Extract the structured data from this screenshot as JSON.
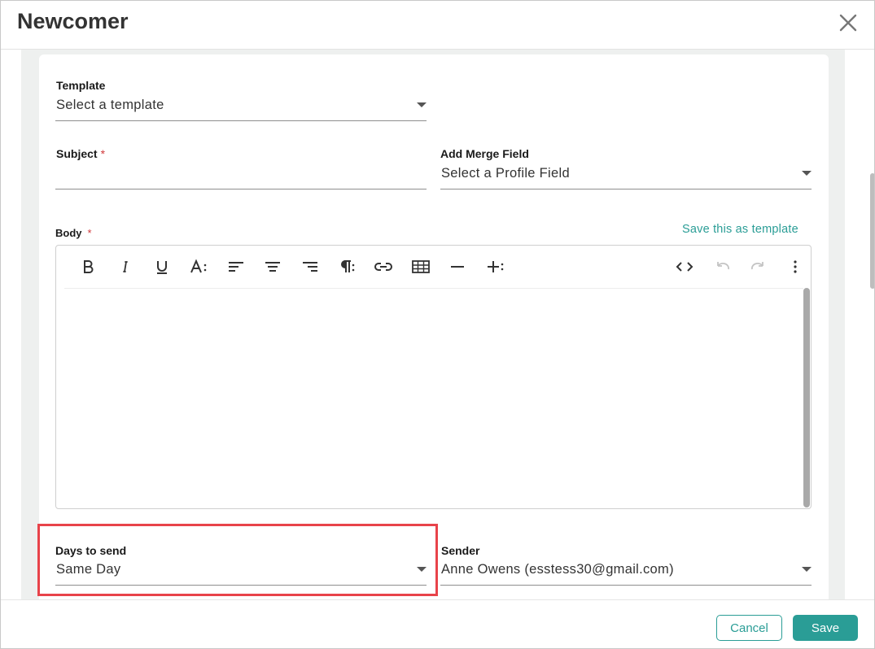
{
  "dialog": {
    "title": "Newcomer"
  },
  "form": {
    "template": {
      "label": "Template",
      "value": "Select a template"
    },
    "subject": {
      "label": "Subject",
      "required_mark": "*",
      "value": ""
    },
    "merge_field": {
      "label": "Add Merge Field",
      "value": "Select a Profile Field"
    },
    "body": {
      "label": "Body",
      "required_mark": "*",
      "save_template_link": "Save this as template"
    },
    "days_to_send": {
      "label": "Days to send",
      "value": "Same Day"
    },
    "sender": {
      "label": "Sender",
      "value": "Anne Owens (esstess30@gmail.com)"
    }
  },
  "toolbar": {
    "icons": [
      "bold-icon",
      "italic-icon",
      "underline-icon",
      "font-size-icon",
      "align-left-icon",
      "align-center-icon",
      "align-right-icon",
      "paragraph-format-icon",
      "link-icon",
      "table-icon",
      "horizontal-rule-icon",
      "insert-more-icon",
      "code-view-icon",
      "undo-icon",
      "redo-icon",
      "more-options-icon"
    ]
  },
  "footer": {
    "cancel_label": "Cancel",
    "save_label": "Save"
  },
  "colors": {
    "accent": "#2a9d96",
    "highlight_border": "#e8434a",
    "required": "#d0393b"
  }
}
